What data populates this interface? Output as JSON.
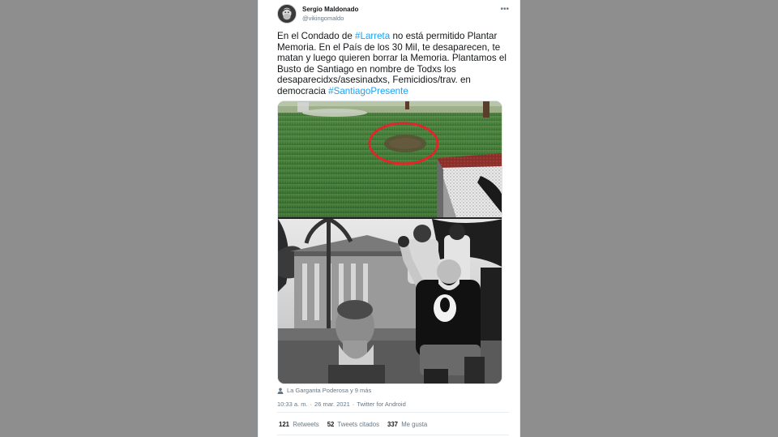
{
  "colors": {
    "page_bg": "#8e8e8e",
    "link": "#1da1f2",
    "text": "#14171a",
    "muted": "#657786"
  },
  "tweet": {
    "author": {
      "name": "Sergio Maldonado",
      "handle": "@vikingomaldo"
    },
    "text": {
      "part1": "En el Condado de ",
      "hashtag1": "#Larreta",
      "part2": " no está permitido Plantar Memoria. En el País de los 30 Mil, te desaparecen, te matan y luego quieren borrar la Memoria. Plantamos el Busto de Santiago en nombre de Todxs los desaparecidxs/asesinadxs, Femicidios/trav. en democracia ",
      "hashtag2": "#SantiagoPresente"
    },
    "tagged": "La Garganta Poderosa y 9 más",
    "time": "10:33 a. m.",
    "separator": "·",
    "date": "26 mar. 2021",
    "client": "Twitter for Android",
    "stats": {
      "retweets_count": "121",
      "retweets_label": "Retweets",
      "quotes_count": "52",
      "quotes_label": "Tweets citados",
      "likes_count": "337",
      "likes_label": "Me gusta"
    }
  },
  "icons": {
    "more": "more-horizontal-icon",
    "tagged": "person-icon"
  }
}
